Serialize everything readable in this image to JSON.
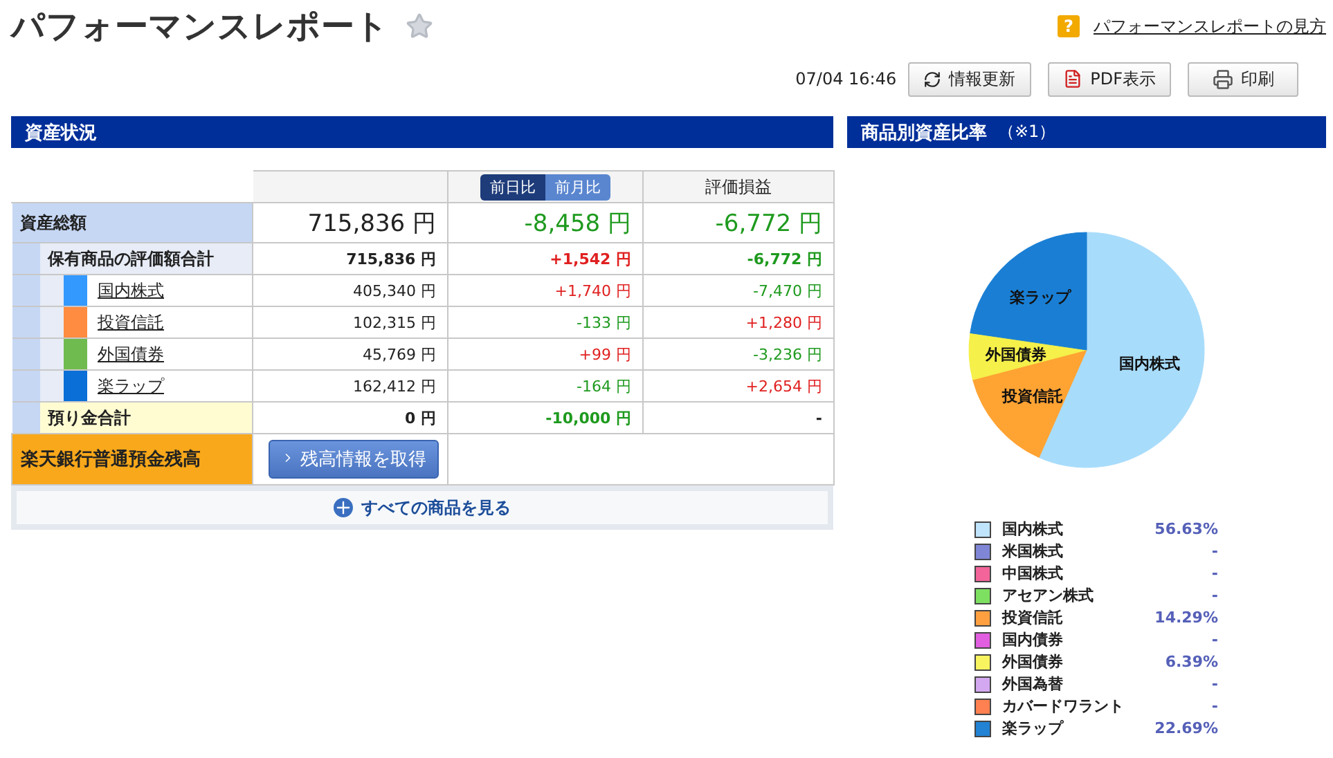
{
  "page": {
    "title": "パフォーマンスレポート",
    "favorite": false,
    "help": {
      "icon": "?",
      "label": "パフォーマンスレポートの見方"
    }
  },
  "toolbar": {
    "timestamp": "07/04 16:46",
    "buttons": [
      {
        "kind": "refresh",
        "label": "情報更新"
      },
      {
        "kind": "pdf",
        "label": "PDF表示"
      },
      {
        "kind": "print",
        "label": "印刷"
      }
    ]
  },
  "assets": {
    "title": "資産状況",
    "columns": [
      {
        "kind": "blank"
      },
      {
        "kind": "toggle",
        "options": [
          {
            "label": "前日比",
            "selected": true
          },
          {
            "label": "前月比",
            "selected": false
          }
        ]
      },
      {
        "kind": "text",
        "label": "評価損益"
      }
    ],
    "rows": [
      {
        "kind": "total",
        "label": "資産総額",
        "values": [
          {
            "text": "715,836 円",
            "color": "#222222"
          },
          {
            "text": "-8,458 円",
            "color": "#1e9a1e"
          },
          {
            "text": "-6,772 円",
            "color": "#1e9a1e"
          }
        ],
        "children": [
          {
            "kind": "subtotal",
            "label": "保有商品の評価額合計",
            "values": [
              {
                "text": "715,836 円",
                "color": "#222222"
              },
              {
                "text": "+1,542 円",
                "color": "#e02020"
              },
              {
                "text": "-6,772 円",
                "color": "#1e9a1e"
              }
            ],
            "children": [
              {
                "kind": "item",
                "label": "国内株式",
                "color": "#3399ff",
                "values": [
                  {
                    "text": "405,340 円",
                    "color": "#222222"
                  },
                  {
                    "text": "+1,740 円",
                    "color": "#e02020"
                  },
                  {
                    "text": "-7,470 円",
                    "color": "#1e9a1e"
                  }
                ]
              },
              {
                "kind": "item",
                "label": "投資信託",
                "color": "#ff8c40",
                "values": [
                  {
                    "text": "102,315 円",
                    "color": "#222222"
                  },
                  {
                    "text": "-133 円",
                    "color": "#1e9a1e"
                  },
                  {
                    "text": "+1,280 円",
                    "color": "#e02020"
                  }
                ]
              },
              {
                "kind": "item",
                "label": "外国債券",
                "color": "#70bb50",
                "values": [
                  {
                    "text": "45,769 円",
                    "color": "#222222"
                  },
                  {
                    "text": "+99 円",
                    "color": "#e02020"
                  },
                  {
                    "text": "-3,236 円",
                    "color": "#1e9a1e"
                  }
                ]
              },
              {
                "kind": "item",
                "label": "楽ラップ",
                "color": "#0a6fd6",
                "values": [
                  {
                    "text": "162,412 円",
                    "color": "#222222"
                  },
                  {
                    "text": "-164 円",
                    "color": "#1e9a1e"
                  },
                  {
                    "text": "+2,654 円",
                    "color": "#e02020"
                  }
                ]
              }
            ]
          },
          {
            "kind": "cash",
            "label": "預り金合計",
            "values": [
              {
                "text": "0 円",
                "color": "#222222"
              },
              {
                "text": "-10,000 円",
                "color": "#1e9a1e"
              },
              {
                "text": "-",
                "color": "#222222"
              }
            ]
          }
        ]
      }
    ],
    "bank": {
      "label": "楽天銀行普通預金残高",
      "button": "残高情報を取得"
    },
    "show_all": "すべての商品を見る"
  },
  "allocation": {
    "title": "商品別資産比率",
    "note": "（※1）",
    "chart_data": {
      "type": "pie",
      "categories": [
        "国内株式",
        "投資信託",
        "外国債券",
        "楽ラップ"
      ],
      "values": [
        56.63,
        14.29,
        6.39,
        22.69
      ],
      "colors": [
        "#a8dcfb",
        "#ffa333",
        "#f5f04a",
        "#1a7fd4"
      ]
    },
    "legend": [
      {
        "label": "国内株式",
        "value": "56.63%",
        "color": "#bfe4fb"
      },
      {
        "label": "米国株式",
        "value": "-",
        "color": "#7f86d6"
      },
      {
        "label": "中国株式",
        "value": "-",
        "color": "#f2649a"
      },
      {
        "label": "アセアン株式",
        "value": "-",
        "color": "#7ee060"
      },
      {
        "label": "投資信託",
        "value": "14.29%",
        "color": "#ffa040"
      },
      {
        "label": "国内債券",
        "value": "-",
        "color": "#e25ee0"
      },
      {
        "label": "外国債券",
        "value": "6.39%",
        "color": "#f8f460"
      },
      {
        "label": "外国為替",
        "value": "-",
        "color": "#d4a8f0"
      },
      {
        "label": "カバードワラント",
        "value": "-",
        "color": "#ff8050"
      },
      {
        "label": "楽ラップ",
        "value": "22.69%",
        "color": "#2282d4"
      }
    ]
  }
}
